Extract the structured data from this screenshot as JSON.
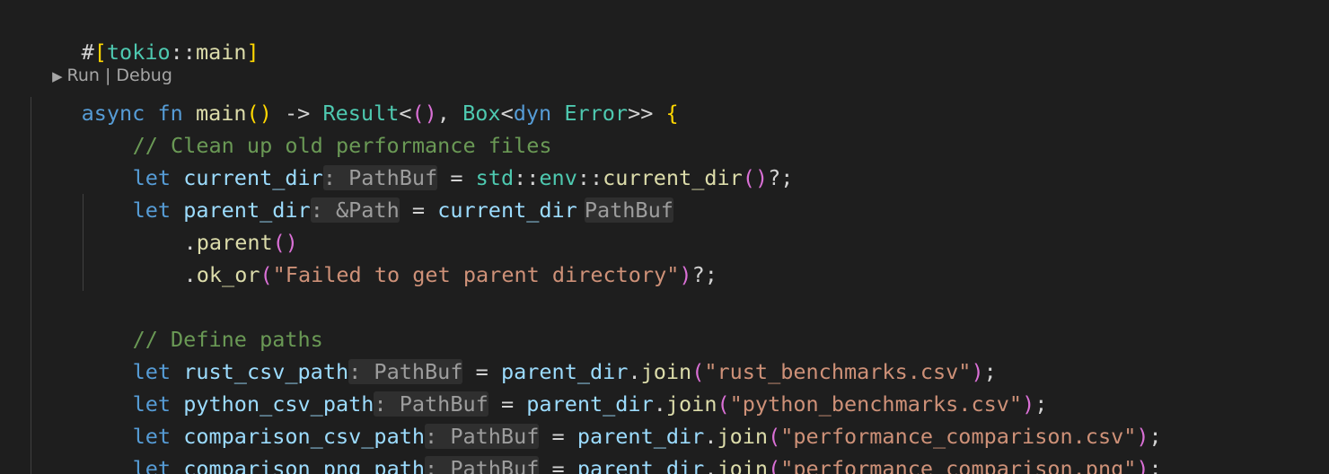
{
  "codelens": {
    "run": "Run",
    "separator": " | ",
    "debug": "Debug",
    "play_icon": "play-icon",
    "play_glyph": "▶ "
  },
  "code": {
    "l1": {
      "hash": "#",
      "open": "[",
      "attr": "tokio",
      "sep": "::",
      "name": "main",
      "close": "]"
    },
    "l2": {
      "async": "async",
      "fn": "fn",
      "name": "main",
      "parens": "()",
      "arrow": "->",
      "result": "Result",
      "lt": "<",
      "unit": "()",
      "comma": ",",
      "box": "Box",
      "lt2": "<",
      "dyn": "dyn",
      "error": "Error",
      "gt": ">>",
      "brace": "{"
    },
    "l3": {
      "comment": "// Clean up old performance files"
    },
    "l4": {
      "let": "let",
      "var": "current_dir",
      "hint": ": PathBuf",
      "eq": "=",
      "std": "std",
      "sep1": "::",
      "env": "env",
      "sep2": "::",
      "call": "current_dir",
      "parens": "()",
      "tail": "?;"
    },
    "l5": {
      "let": "let",
      "var": "parent_dir",
      "hint": ": &Path",
      "eq": "=",
      "ref": "current_dir",
      "hint2": "PathBuf"
    },
    "l6": {
      "dot": ".",
      "method": "parent",
      "parens": "()"
    },
    "l7": {
      "dot": ".",
      "method": "ok_or",
      "open": "(",
      "str": "\"Failed to get parent directory\"",
      "close": ")",
      "tail": "?;"
    },
    "l9": {
      "comment": "// Define paths"
    },
    "l10": {
      "let": "let",
      "var": "rust_csv_path",
      "hint": ": PathBuf",
      "eq": "=",
      "obj": "parent_dir",
      "dot": ".",
      "method": "join",
      "open": "(",
      "str": "\"rust_benchmarks.csv\"",
      "close": ")",
      "semi": ";"
    },
    "l11": {
      "let": "let",
      "var": "python_csv_path",
      "hint": ": PathBuf",
      "eq": "=",
      "obj": "parent_dir",
      "dot": ".",
      "method": "join",
      "open": "(",
      "str": "\"python_benchmarks.csv\"",
      "close": ")",
      "semi": ";"
    },
    "l12": {
      "let": "let",
      "var": "comparison_csv_path",
      "hint": ": PathBuf",
      "eq": "=",
      "obj": "parent_dir",
      "dot": ".",
      "method": "join",
      "open": "(",
      "str": "\"performance_comparison.csv\"",
      "close": ")",
      "semi": ";"
    },
    "l13": {
      "let": "let",
      "var": "comparison_png_path",
      "hint": ": PathBuf",
      "eq": "=",
      "obj": "parent_dir",
      "dot": ".",
      "method": "join",
      "open": "(",
      "str": "\"performance_comparison.png\"",
      "close": ")",
      "semi": ";"
    }
  },
  "colors": {
    "background": "#1e1e1e",
    "keyword": "#569cd6",
    "function": "#dcdcaa",
    "type": "#4ec9b0",
    "variable": "#9cdcfe",
    "string": "#ce9178",
    "comment": "#6a9955",
    "bracket_level1": "#ffd700",
    "bracket_level2": "#da70d6",
    "inlay_hint_bg": "#2f2f2f"
  }
}
